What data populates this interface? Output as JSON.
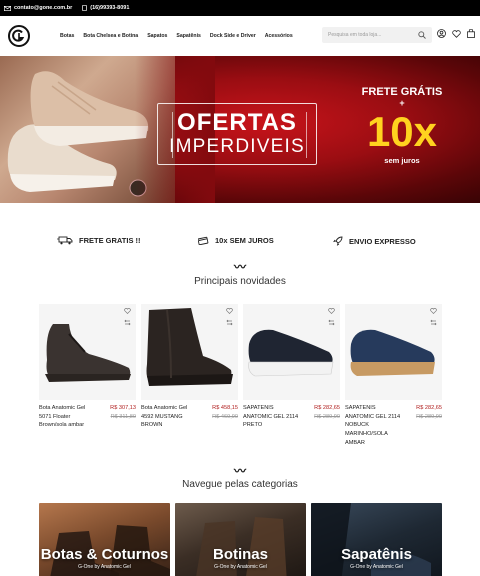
{
  "topbar": {
    "email": "contato@gone.com.br",
    "phone": "(16)99393-8091"
  },
  "header": {
    "logo_icon": "brand-logo",
    "nav": [
      "Botas",
      "Bota Chelsea e Botina",
      "Sapatos",
      "Sapatênis",
      "Dock Side e Driver",
      "Acessórios"
    ],
    "search_placeholder": "Pesquisa em toda loja...",
    "icons": [
      "search-icon",
      "user-icon",
      "heart-icon",
      "cart-icon"
    ]
  },
  "banner": {
    "title": "OFERTAS",
    "subtitle": "IMPERDIVEIS",
    "frete": "FRETE GRÁTIS",
    "plus": "+",
    "installments": "10x",
    "no_interest": "sem juros",
    "accent": "#ffd21f"
  },
  "benefits": [
    {
      "icon": "truck-icon",
      "label": "FRETE GRATIS !!"
    },
    {
      "icon": "card-icon",
      "label": "10x SEM JUROS"
    },
    {
      "icon": "rocket-icon",
      "label": "ENVIO EXPRESSO"
    }
  ],
  "new_section": {
    "tilde": "〰",
    "title": "Principais novidades"
  },
  "products": [
    {
      "name": "Bota Anatomic Gel 5071 Floater Brown/sola ambar",
      "price": "R$ 307,13",
      "old_price": "R$ 311,80"
    },
    {
      "name": "Bota Anatomic Gel 4592 MUSTANG BROWN",
      "price": "R$ 458,15",
      "old_price": "R$ 469,90"
    },
    {
      "name": "SAPATENIS ANATOMIC GEL 2114 PRETO",
      "price": "R$ 282,65",
      "old_price": "R$ 289,90"
    },
    {
      "name": "SAPATENIS ANATOMIC GEL 2114 NOBUCK MARINHO/SOLA AMBAR",
      "price": "R$ 282,65",
      "old_price": "R$ 289,90"
    }
  ],
  "categories_section": {
    "tilde": "〰",
    "title": "Navegue pelas categorias"
  },
  "categories": [
    {
      "label": "Botas & Coturnos",
      "sub": "G-One by Anatomic Gel"
    },
    {
      "label": "Botinas",
      "sub": "G-One by Anatomic Gel"
    },
    {
      "label": "Sapatênis",
      "sub": "G-One by Anatomic Gel"
    }
  ]
}
